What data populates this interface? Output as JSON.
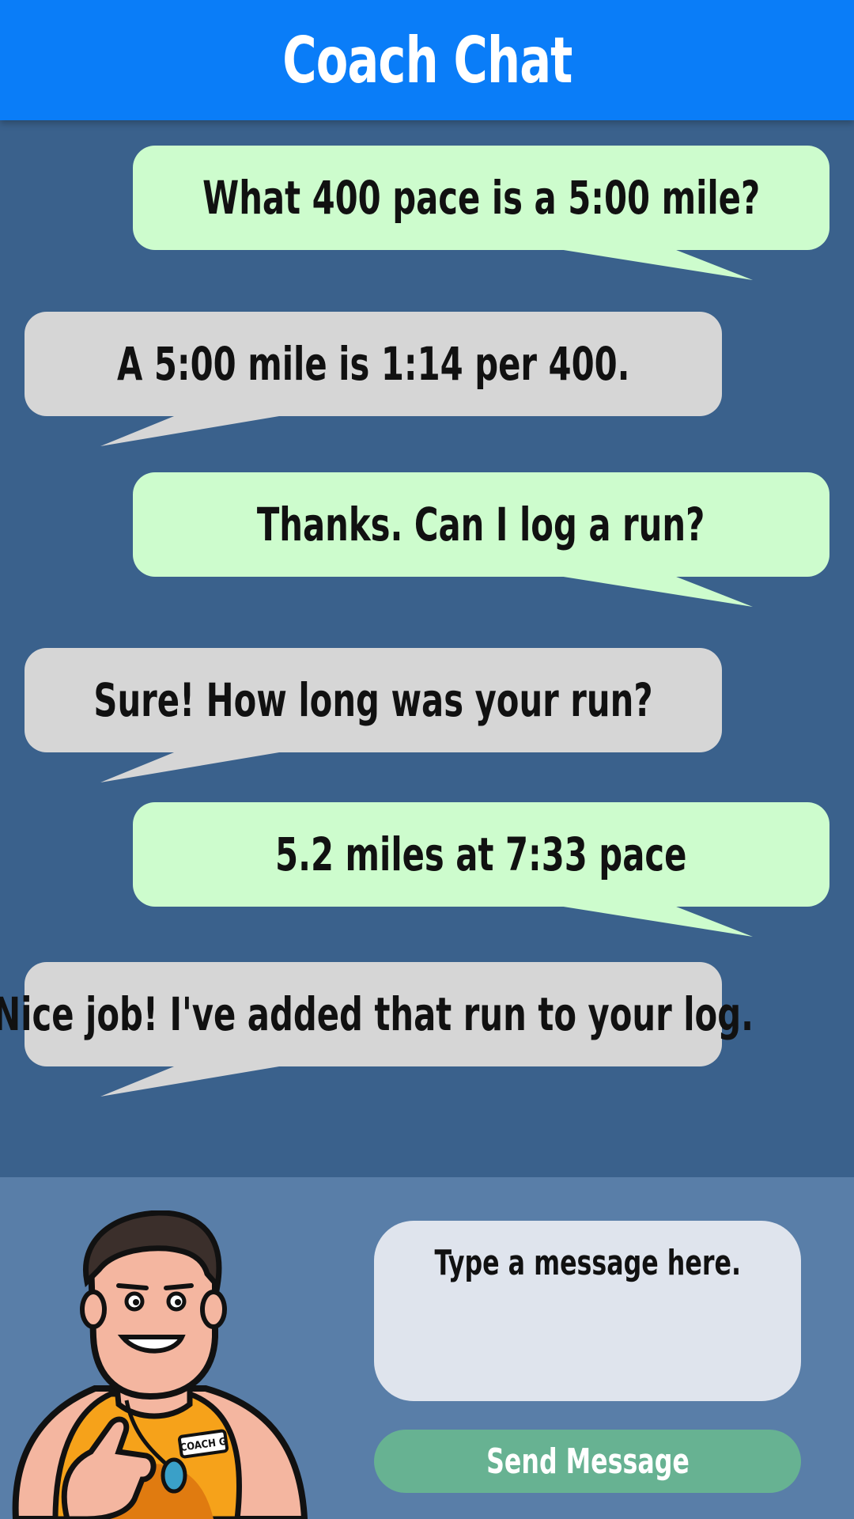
{
  "header": {
    "title": "Coach Chat"
  },
  "messages": [
    {
      "sender": "user",
      "text": "What 400 pace is a 5:00 mile?"
    },
    {
      "sender": "coach",
      "text": "A 5:00 mile is 1:14 per 400."
    },
    {
      "sender": "user",
      "text": "Thanks. Can I log a run?"
    },
    {
      "sender": "coach",
      "text": "Sure! How long was your run?"
    },
    {
      "sender": "user",
      "text": "5.2 miles at 7:33 pace"
    },
    {
      "sender": "coach",
      "text": "Nice job! I've added that run to your log."
    }
  ],
  "composer": {
    "placeholder": "Type a message here.",
    "send_label": "Send Message"
  },
  "avatar": {
    "badge_text": "COACH G",
    "icon": "coach-mascot-icon"
  },
  "colors": {
    "header": "#0a7df8",
    "chat_bg": "#3a618c",
    "user_bubble": "#cdfccd",
    "coach_bubble": "#d6d6d6",
    "composer_bg": "#597ea8",
    "send_button": "#67b292"
  }
}
